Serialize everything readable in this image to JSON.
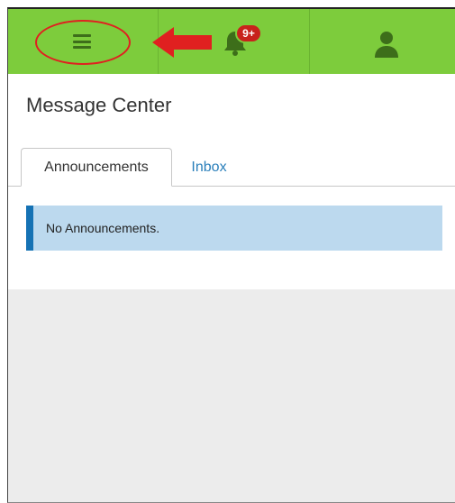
{
  "topbar": {
    "menu_icon": "hamburger-menu-icon",
    "notifications_icon": "bell-icon",
    "notifications_badge": "9+",
    "profile_icon": "user-icon",
    "background_color": "#7dcc3c"
  },
  "annotation": {
    "color": "#e02020",
    "shapes": [
      "ellipse",
      "arrow"
    ]
  },
  "page": {
    "title": "Message Center"
  },
  "tabs": [
    {
      "label": "Announcements",
      "active": true
    },
    {
      "label": "Inbox",
      "active": false
    }
  ],
  "alert": {
    "message": "No Announcements.",
    "accent_color": "#1572b4",
    "background_color": "#bcd9ee"
  }
}
